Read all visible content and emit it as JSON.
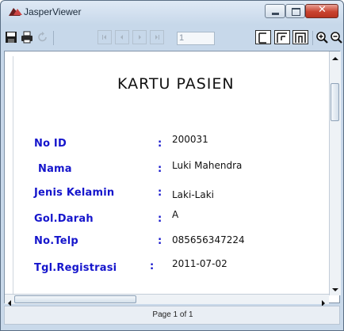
{
  "window": {
    "title": "JasperViewer"
  },
  "toolbar": {
    "page_number": "1"
  },
  "report": {
    "title": "KARTU PASIEN",
    "fields": [
      {
        "label": "No ID",
        "colon": ":",
        "value": "200031"
      },
      {
        "label": "Nama",
        "colon": ":",
        "value": "Luki Mahendra"
      },
      {
        "label": "Jenis Kelamin",
        "colon": ":",
        "value": "Laki-Laki"
      },
      {
        "label": "Gol.Darah",
        "colon": ":",
        "value": "A"
      },
      {
        "label": "No.Telp",
        "colon": ":",
        "value": "085656347224"
      },
      {
        "label": "Tgl.Registrasi",
        "colon": ":",
        "value": "2011-07-02"
      }
    ]
  },
  "status": {
    "text": "Page 1 of 1"
  }
}
